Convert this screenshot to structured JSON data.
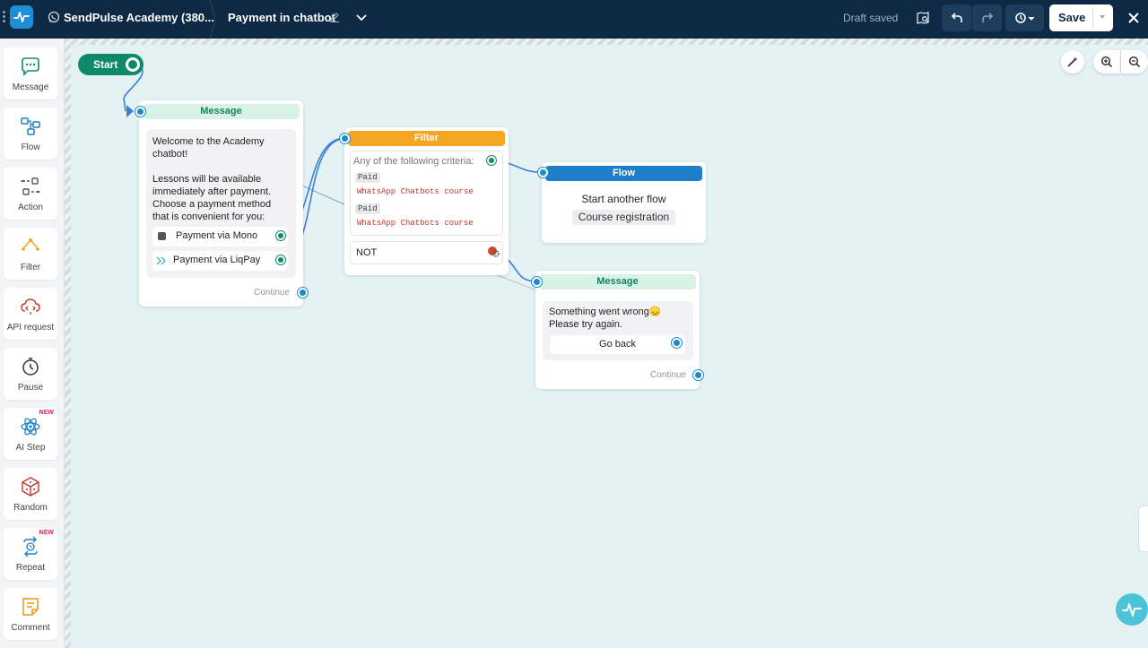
{
  "topbar": {
    "project": "SendPulse Academy (380...",
    "flow_name": "Payment in chatbot",
    "status": "Draft saved",
    "save_label": "Save"
  },
  "sidebar": {
    "items": [
      {
        "label": "Message",
        "icon": "message-icon"
      },
      {
        "label": "Flow",
        "icon": "flow-icon"
      },
      {
        "label": "Action",
        "icon": "action-icon"
      },
      {
        "label": "Filter",
        "icon": "filter-icon"
      },
      {
        "label": "API request",
        "icon": "api-request-icon"
      },
      {
        "label": "Pause",
        "icon": "pause-icon"
      },
      {
        "label": "AI Step",
        "icon": "ai-step-icon",
        "badge": "NEW"
      },
      {
        "label": "Random",
        "icon": "random-icon"
      },
      {
        "label": "Repeat",
        "icon": "repeat-icon",
        "badge": "NEW"
      },
      {
        "label": "Comment",
        "icon": "comment-icon"
      }
    ]
  },
  "canvas": {
    "start_label": "Start",
    "message1": {
      "title": "Message",
      "text": "Welcome to the Academy\nchatbot!\n\nLessons will be available\nimmediately after payment.\nChoose a payment method\nthat is convenient for you:",
      "buttons": [
        "Payment via Mono",
        "Payment via LiqPay"
      ],
      "continue": "Continue"
    },
    "filter": {
      "title": "Filter",
      "criteria": "Any of the following criteria:",
      "conditions": [
        {
          "tag": "Paid",
          "value": "WhatsApp Chatbots course"
        },
        {
          "tag": "Paid",
          "value": "WhatsApp Chatbots course"
        }
      ],
      "not_label": "NOT"
    },
    "flow": {
      "title": "Flow",
      "subtitle": "Start another flow",
      "target": "Course registration"
    },
    "message2": {
      "title": "Message",
      "text": "Something went wrong😞\nPlease try again.",
      "button": "Go back",
      "continue": "Continue"
    }
  },
  "colors": {
    "topbar": "#0d2944",
    "message_header": "#d9f2e6",
    "filter_header": "#f6a623",
    "flow_header": "#1e7fc8",
    "connection": "#3d7fd4",
    "start": "#0e8a6a"
  }
}
